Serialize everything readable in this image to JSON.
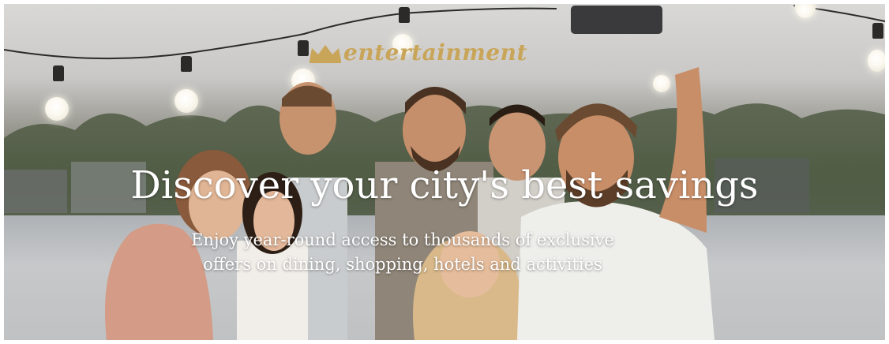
{
  "banner": {
    "brand": "entertainment",
    "headline": "Discover your city's best savings",
    "subline_1": "Enjoy year-round access to thousands of exclusive",
    "subline_2": "offers on dining, shopping, hotels and activities"
  },
  "icons": {
    "brand_mark": "crown-icon"
  },
  "colors": {
    "brand_gold": "#c9a55a",
    "text": "#ffffff"
  }
}
